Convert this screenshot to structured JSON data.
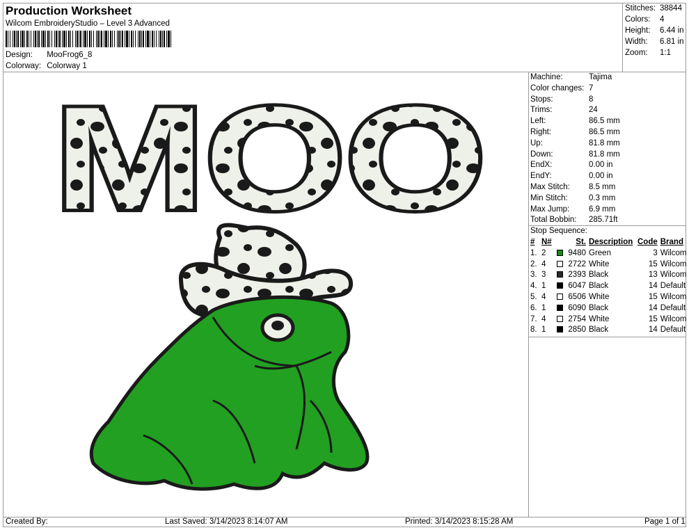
{
  "header": {
    "title": "Production Worksheet",
    "subtitle": "Wilcom EmbroideryStudio – Level 3 Advanced",
    "design_label": "Design:",
    "design_value": "MooFrog6_8",
    "colorway_label": "Colorway:",
    "colorway_value": "Colorway 1"
  },
  "summary": [
    {
      "label": "Stitches:",
      "value": "38844"
    },
    {
      "label": "Colors:",
      "value": "4"
    },
    {
      "label": "Height:",
      "value": "6.44 in"
    },
    {
      "label": "Width:",
      "value": "6.81 in"
    },
    {
      "label": "Zoom:",
      "value": "1:1"
    }
  ],
  "machine_info": [
    {
      "label": "Machine:",
      "value": "Tajima"
    },
    {
      "label": "Color changes:",
      "value": "7"
    },
    {
      "label": "Stops:",
      "value": "8"
    },
    {
      "label": "Trims:",
      "value": "24"
    },
    {
      "label": "Left:",
      "value": "86.5 mm"
    },
    {
      "label": "Right:",
      "value": "86.5 mm"
    },
    {
      "label": "Up:",
      "value": "81.8 mm"
    },
    {
      "label": "Down:",
      "value": "81.8 mm"
    },
    {
      "label": "EndX:",
      "value": "0.00 in"
    },
    {
      "label": "EndY:",
      "value": "0.00 in"
    },
    {
      "label": "Max Stitch:",
      "value": "8.5 mm"
    },
    {
      "label": "Min Stitch:",
      "value": "0.3 mm"
    },
    {
      "label": "Max Jump:",
      "value": "6.9 mm"
    },
    {
      "label": "Total Bobbin:",
      "value": "285.71ft"
    }
  ],
  "stop_sequence": {
    "title": "Stop Sequence:",
    "headers": [
      "#",
      "N#",
      "St.",
      "Description",
      "Code",
      "Brand"
    ],
    "rows": [
      {
        "num": "1.",
        "n": "2",
        "color": "#1a8a1a",
        "st": "9480",
        "desc": "Green",
        "code": "3",
        "brand": "Wilcom"
      },
      {
        "num": "2.",
        "n": "4",
        "color": "#ffffff",
        "st": "2722",
        "desc": "White",
        "code": "15",
        "brand": "Wilcom"
      },
      {
        "num": "3.",
        "n": "3",
        "color": "#2a2a2a",
        "st": "2393",
        "desc": "Black",
        "code": "13",
        "brand": "Wilcom"
      },
      {
        "num": "4.",
        "n": "1",
        "color": "#000000",
        "st": "6047",
        "desc": "Black",
        "code": "14",
        "brand": "Default"
      },
      {
        "num": "5.",
        "n": "4",
        "color": "#ffffff",
        "st": "6506",
        "desc": "White",
        "code": "15",
        "brand": "Wilcom"
      },
      {
        "num": "6.",
        "n": "1",
        "color": "#000000",
        "st": "6090",
        "desc": "Black",
        "code": "14",
        "brand": "Default"
      },
      {
        "num": "7.",
        "n": "4",
        "color": "#ffffff",
        "st": "2754",
        "desc": "White",
        "code": "15",
        "brand": "Wilcom"
      },
      {
        "num": "8.",
        "n": "1",
        "color": "#000000",
        "st": "2850",
        "desc": "Black",
        "code": "14",
        "brand": "Default"
      }
    ]
  },
  "design_preview": {
    "text": "MOO"
  },
  "footer": {
    "created_by": "Created By:",
    "last_saved": "Last Saved: 3/14/2023 8:14:07 AM",
    "printed": "Printed: 3/14/2023 8:15:28 AM",
    "page": "Page 1 of 1"
  },
  "colors": {
    "frog_green": "#22a022",
    "outline": "#1a1a1a",
    "cow_white": "#eef0ea",
    "grid_line": "#9a9a9a"
  }
}
